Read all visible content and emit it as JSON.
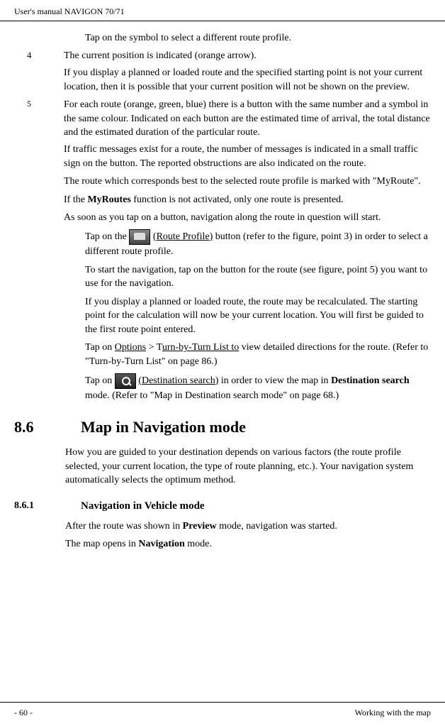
{
  "header": {
    "title": "User's manual NAVIGON 70/71"
  },
  "items": {
    "pre_para": "Tap on the symbol to select a different route profile.",
    "item4_num": "4",
    "item4_text": "The current position is indicated (orange arrow).",
    "item4_para2": "If you display a planned or loaded route and the specified starting point is not your current location, then it is possible that your current position will not be shown on the preview.",
    "item5_num": "5",
    "item5_text": "For each route (orange, green, blue) there is a button with the same number and a symbol in the same colour. Indicated on each button are the estimated time of arrival, the total distance and the estimated duration of the particular route.",
    "item5_para2": "If traffic messages exist for a route, the number of messages is indicated in a small traffic sign on the button. The reported obstructions are also indicated on the route.",
    "item5_para3": "The route which corresponds best to the selected route profile is marked with \"MyRoute\".",
    "item5_para4_prefix": "If the ",
    "item5_para4_bold": "MyRoutes",
    "item5_para4_suffix": " function is not activated, only one route is presented.",
    "item5_para5": "As soon as you tap on a button, navigation along the route in question will start.",
    "indent1_prefix": "Tap on the ",
    "indent1_link": " (Route Profile)",
    "indent1_suffix": " button (refer to the figure, point 3) in order to select a different route profile.",
    "indent2": "To start the navigation, tap on the button for the route (see figure, point 5) you want to use for the navigation.",
    "indent3": "If you display a planned or loaded route, the route may be recalculated. The starting point for the calculation will now be your current location. You will first be guided to the first route point entered.",
    "indent4_prefix": "Tap on ",
    "indent4_link1": "Options",
    "indent4_gt": " > T",
    "indent4_link2": "urn-by-Turn List to",
    "indent4_suffix": " view detailed directions for the route. (Refer to \"Turn-by-Turn List\" on page 86.)",
    "indent5_prefix": "Tap on ",
    "indent5_link": " (Destination search)",
    "indent5_mid": " in order to view the map in ",
    "indent5_bold": "Destination search",
    "indent5_suffix": " mode. (Refer to \"Map in Destination search mode\" on page 68.)"
  },
  "section": {
    "num": "8.6",
    "title": "Map in Navigation mode",
    "para": "How you are guided to your destination depends on various factors (the route profile selected, your current location, the type of route planning, etc.). Your navigation system automatically selects the optimum method."
  },
  "subsection": {
    "num": "8.6.1",
    "title": "Navigation in Vehicle mode",
    "para1_prefix": "After the route was shown in ",
    "para1_bold": "Preview",
    "para1_suffix": " mode, navigation was started.",
    "para2_prefix": "The map opens in ",
    "para2_bold": "Navigation",
    "para2_suffix": " mode."
  },
  "footer": {
    "page": "- 60 -",
    "right": "Working with the map"
  }
}
